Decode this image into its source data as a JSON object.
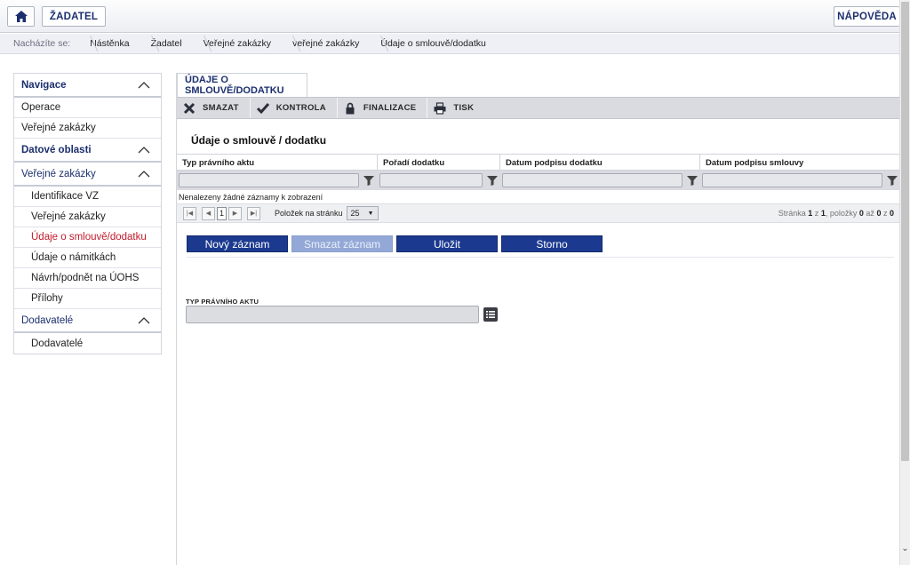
{
  "header": {
    "home_icon": "home-icon",
    "zadatel_label": "ŽADATEL",
    "help_label": "NÁPOVĚDA"
  },
  "breadcrumb": {
    "label": "Nacházíte se:",
    "items": [
      "Nástěnka",
      "Žadatel",
      "Veřejné zakázky",
      "veřejné zakázky",
      "Údaje o smlouvě/dodatku"
    ]
  },
  "sidebar": {
    "navigace": {
      "title": "Navigace",
      "items": [
        "Operace",
        "Veřejné zakázky"
      ]
    },
    "datove_oblasti": {
      "title": "Datové oblasti"
    },
    "verejne_zakazky": {
      "title": "Veřejné zakázky",
      "items": [
        "Identifikace VZ",
        "Veřejné zakázky",
        "Údaje o smlouvě/dodatku",
        "Údaje o námitkách",
        "Návrh/podnět na ÚOHS",
        "Přílohy"
      ],
      "active_index": 2
    },
    "dodavatele": {
      "title": "Dodavatelé",
      "items": [
        "Dodavatelé"
      ]
    }
  },
  "main": {
    "tab_label": "ÚDAJE O SMLOUVĚ/DODATKU",
    "toolbar": {
      "smazat": "SMAZAT",
      "kontrola": "KONTROLA",
      "finalizace": "FINALIZACE",
      "tisk": "TISK"
    },
    "section_title": "Údaje o smlouvě / dodatku",
    "grid": {
      "columns": [
        "Typ právního aktu",
        "Pořadí dodatku",
        "Datum podpisu dodatku",
        "Datum podpisu smlouvy"
      ],
      "empty_message": "Nenalezeny žádné záznamy k zobrazení"
    },
    "pager": {
      "current_page": "1",
      "per_page_label": "Položek na stránku",
      "per_page_value": "25",
      "info_prefix": "Stránka",
      "page": "1",
      "of1": "z",
      "pages": "1",
      "items_label": ", položky",
      "from": "0",
      "to_label": "až",
      "to": "0",
      "of2": "z",
      "total": "0"
    },
    "actions": {
      "new": "Nový záznam",
      "delete": "Smazat záznam",
      "save": "Uložit",
      "cancel": "Storno"
    },
    "field": {
      "label": "TYP PRÁVNÍHO AKTU",
      "value": ""
    }
  },
  "colors": {
    "brand_blue": "#1b3a8f",
    "title_blue": "#1b2f6e",
    "active_red": "#c01b2b",
    "disabled_blue": "#93a8d6"
  }
}
